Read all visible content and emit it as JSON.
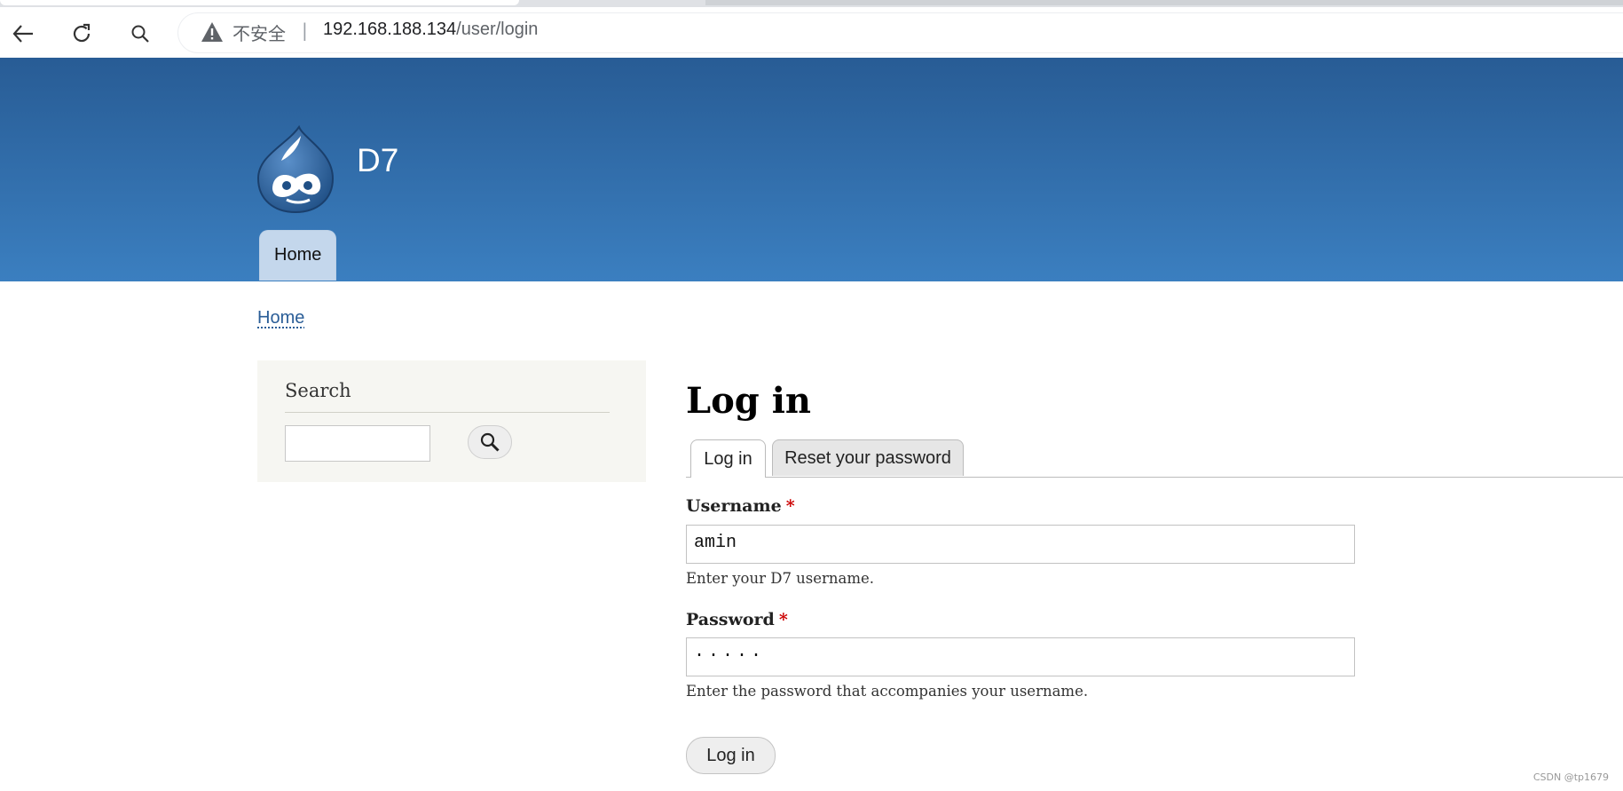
{
  "browser": {
    "insecure_label": "不安全",
    "separator": "|",
    "url_host": "192.168.188.134",
    "url_path": "/user/login",
    "icons": [
      "back-arrow-icon",
      "reload-icon",
      "search-icon",
      "warning-icon"
    ]
  },
  "site": {
    "name": "D7",
    "menu": [
      {
        "label": "Home"
      }
    ],
    "breadcrumb": "Home",
    "header_gradient": [
      "#285c95",
      "#3b7fc0"
    ]
  },
  "sidebar": {
    "search_block_title": "Search",
    "search_value": "",
    "search_button_icon": "magnifier-icon"
  },
  "main": {
    "title": "Log in",
    "tabs": [
      {
        "label": "Log in",
        "active": true
      },
      {
        "label": "Reset your password",
        "active": false
      }
    ],
    "username": {
      "label": "Username",
      "required_marker": "*",
      "value": "amin",
      "description": "Enter your D7 username."
    },
    "password": {
      "label": "Password",
      "required_marker": "*",
      "value": "·····",
      "description": "Enter the password that accompanies your username."
    },
    "submit_label": "Log in"
  },
  "watermark": "CSDN @tp1679"
}
